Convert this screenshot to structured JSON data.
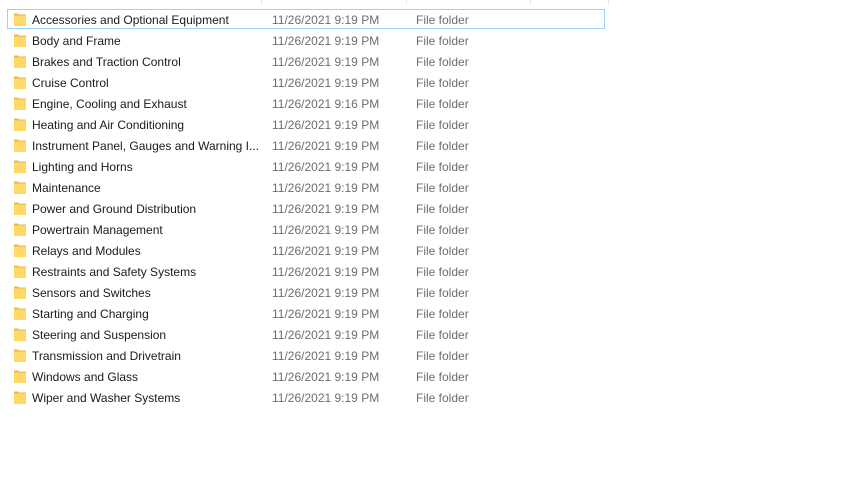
{
  "explorer": {
    "rows": [
      {
        "name": "Accessories and Optional Equipment",
        "date": "11/26/2021 9:19 PM",
        "type": "File folder",
        "icon": "folder-icon",
        "focused": true
      },
      {
        "name": "Body and Frame",
        "date": "11/26/2021 9:19 PM",
        "type": "File folder",
        "icon": "folder-icon"
      },
      {
        "name": "Brakes and Traction Control",
        "date": "11/26/2021 9:19 PM",
        "type": "File folder",
        "icon": "folder-icon"
      },
      {
        "name": "Cruise Control",
        "date": "11/26/2021 9:19 PM",
        "type": "File folder",
        "icon": "folder-icon"
      },
      {
        "name": "Engine, Cooling and Exhaust",
        "date": "11/26/2021 9:16 PM",
        "type": "File folder",
        "icon": "folder-icon"
      },
      {
        "name": "Heating and Air Conditioning",
        "date": "11/26/2021 9:19 PM",
        "type": "File folder",
        "icon": "folder-icon"
      },
      {
        "name": "Instrument Panel, Gauges and Warning I...",
        "date": "11/26/2021 9:19 PM",
        "type": "File folder",
        "icon": "folder-icon"
      },
      {
        "name": "Lighting and Horns",
        "date": "11/26/2021 9:19 PM",
        "type": "File folder",
        "icon": "folder-icon"
      },
      {
        "name": "Maintenance",
        "date": "11/26/2021 9:19 PM",
        "type": "File folder",
        "icon": "folder-icon"
      },
      {
        "name": "Power and Ground Distribution",
        "date": "11/26/2021 9:19 PM",
        "type": "File folder",
        "icon": "folder-icon"
      },
      {
        "name": "Powertrain Management",
        "date": "11/26/2021 9:19 PM",
        "type": "File folder",
        "icon": "folder-icon"
      },
      {
        "name": "Relays and Modules",
        "date": "11/26/2021 9:19 PM",
        "type": "File folder",
        "icon": "folder-icon"
      },
      {
        "name": "Restraints and Safety Systems",
        "date": "11/26/2021 9:19 PM",
        "type": "File folder",
        "icon": "folder-icon"
      },
      {
        "name": "Sensors and Switches",
        "date": "11/26/2021 9:19 PM",
        "type": "File folder",
        "icon": "folder-icon"
      },
      {
        "name": "Starting and Charging",
        "date": "11/26/2021 9:19 PM",
        "type": "File folder",
        "icon": "folder-icon"
      },
      {
        "name": "Steering and Suspension",
        "date": "11/26/2021 9:19 PM",
        "type": "File folder",
        "icon": "folder-icon"
      },
      {
        "name": "Transmission and Drivetrain",
        "date": "11/26/2021 9:19 PM",
        "type": "File folder",
        "icon": "folder-icon"
      },
      {
        "name": "Windows and Glass",
        "date": "11/26/2021 9:19 PM",
        "type": "File folder",
        "icon": "folder-icon"
      },
      {
        "name": "Wiper and Washer Systems",
        "date": "11/26/2021 9:19 PM",
        "type": "File folder",
        "icon": "folder-icon"
      }
    ]
  },
  "colors": {
    "folder_body": "#ffd867",
    "folder_tab": "#e8b84a",
    "focus_border": "#99d1ff",
    "secondary_text": "#6d6d6d"
  }
}
